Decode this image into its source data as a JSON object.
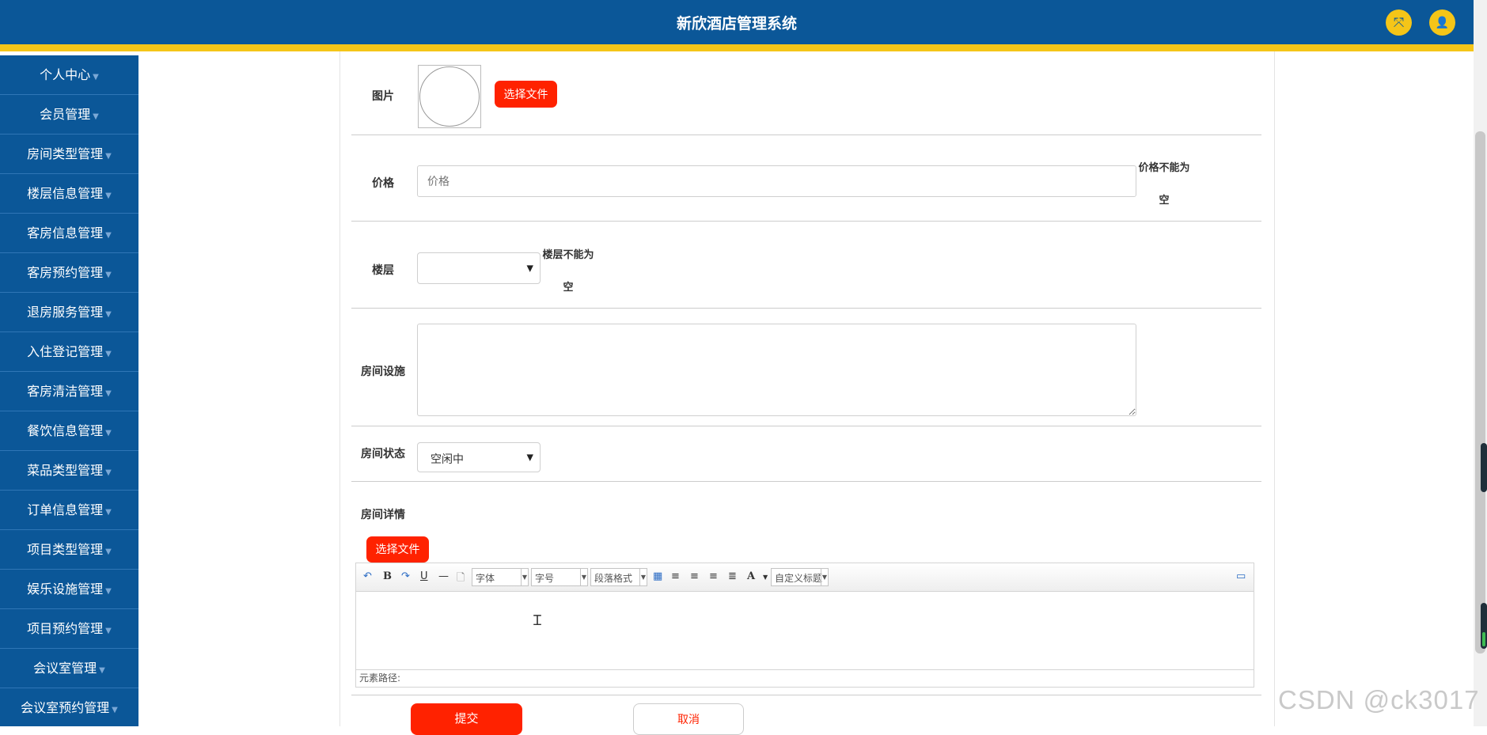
{
  "app": {
    "title": "新欣酒店管理系统"
  },
  "header": {
    "icons": [
      {
        "name": "fullscreen-icon",
        "glyph": "⤧"
      },
      {
        "name": "user-icon",
        "glyph": "👤"
      }
    ],
    "accent": "#f5c518",
    "bg": "#0b5798"
  },
  "sidebar": {
    "items": [
      {
        "label": "个人中心"
      },
      {
        "label": "会员管理"
      },
      {
        "label": "房间类型管理"
      },
      {
        "label": "楼层信息管理"
      },
      {
        "label": "客房信息管理"
      },
      {
        "label": "客房预约管理"
      },
      {
        "label": "退房服务管理"
      },
      {
        "label": "入住登记管理"
      },
      {
        "label": "客房清洁管理"
      },
      {
        "label": "餐饮信息管理"
      },
      {
        "label": "菜品类型管理"
      },
      {
        "label": "订单信息管理"
      },
      {
        "label": "项目类型管理"
      },
      {
        "label": "娱乐设施管理"
      },
      {
        "label": "项目预约管理"
      },
      {
        "label": "会议室管理"
      },
      {
        "label": "会议室预约管理"
      }
    ]
  },
  "form": {
    "image": {
      "label": "图片",
      "button": "选择文件"
    },
    "price": {
      "label": "价格",
      "placeholder": "价格",
      "error_line1": "价格不能为",
      "error_line2": "空"
    },
    "floor": {
      "label": "楼层",
      "value": "",
      "error_line1": "楼层不能为",
      "error_line2": "空"
    },
    "facilities": {
      "label": "房间设施",
      "value": ""
    },
    "status": {
      "label": "房间状态",
      "value": "空闲中"
    },
    "details": {
      "label": "房间详情",
      "button": "选择文件"
    }
  },
  "editor": {
    "combos": {
      "font": "字体",
      "size": "字号",
      "paragraph": "段落格式",
      "custom_title": "自定义标题"
    },
    "toolbar_glyphs": {
      "undo": "↶",
      "bold": "B",
      "redo": "↷",
      "underline": "U",
      "hr": "—",
      "doc": "🗋",
      "table": "▦",
      "align_left": "≡",
      "align_right": "≡",
      "align_center": "≡",
      "justify": "≣",
      "font_color": "A",
      "preview": "▭"
    },
    "footer": "元素路径:"
  },
  "actions": {
    "submit": "提交",
    "cancel": "取消"
  },
  "watermark": "CSDN @ck3017"
}
